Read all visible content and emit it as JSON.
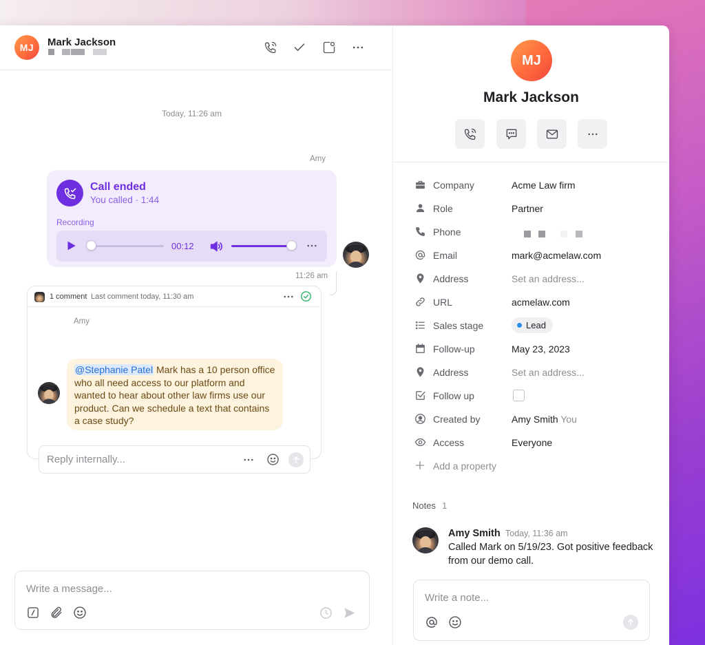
{
  "header": {
    "avatar_initials": "MJ",
    "contact_name": "Mark Jackson",
    "icons": [
      "phone-icon",
      "check-icon",
      "panel-icon",
      "more-icon"
    ]
  },
  "conversation": {
    "date_label": "Today, 11:26 am",
    "sender_name": "Amy",
    "call": {
      "title": "Call ended",
      "subtitle": "You called · 1:44",
      "recording_label": "Recording",
      "playback_time": "00:12",
      "playback_progress": 0,
      "volume_level": 0.95
    },
    "message_time": "11:26 am",
    "comments": {
      "count_label": "1 comment",
      "last_label": "Last comment today, 11:30 am",
      "author": "Amy",
      "mention": "@Stephanie Patel",
      "text": " Mark has a 10 person office who all need access to our platform and wanted to hear about other law firms use our product. Can we schedule a text that contains a case study?",
      "reply_placeholder": "Reply internally..."
    },
    "composer_placeholder": "Write a message..."
  },
  "profile": {
    "avatar_initials": "MJ",
    "name": "Mark Jackson",
    "properties": [
      {
        "label": "Company",
        "value": "Acme Law firm",
        "icon": "briefcase-icon"
      },
      {
        "label": "Role",
        "value": "Partner",
        "icon": "person-icon"
      },
      {
        "label": "Phone",
        "value": "",
        "icon": "phone-icon"
      },
      {
        "label": "Email",
        "value": "mark@acmelaw.com",
        "icon": "at-icon"
      },
      {
        "label": "Address",
        "value": "Set an address...",
        "icon": "pin-icon"
      },
      {
        "label": "URL",
        "value": "acmelaw.com",
        "icon": "link-icon"
      },
      {
        "label": "Sales stage",
        "value": "Lead",
        "icon": "list-icon"
      },
      {
        "label": "Follow-up",
        "value": "May 23, 2023",
        "icon": "calendar-icon"
      },
      {
        "label": "Address",
        "value": "Set an address...",
        "icon": "pin-icon"
      },
      {
        "label": "Follow up",
        "value": "",
        "icon": "checkbox-icon"
      },
      {
        "label": "Created by",
        "value": "Amy Smith",
        "suffix": "You",
        "icon": "user-circle-icon"
      },
      {
        "label": "Access",
        "value": "Everyone",
        "icon": "eye-icon"
      }
    ],
    "add_property_label": "Add a property",
    "notes": {
      "heading": "Notes",
      "count": "1",
      "author": "Amy Smith",
      "time": "Today, 11:36 am",
      "text": "Called Mark on 5/19/23. Got positive feedback from our demo call.",
      "placeholder": "Write a note..."
    }
  },
  "colors": {
    "accent_purple": "#6d2fe0",
    "call_bg": "#f3ecfc",
    "bubble_bg": "#fdf3df",
    "avatar_orange": "#ff6a3d",
    "lead_dot": "#2b8ce8",
    "resolved_green": "#2fb36a"
  }
}
